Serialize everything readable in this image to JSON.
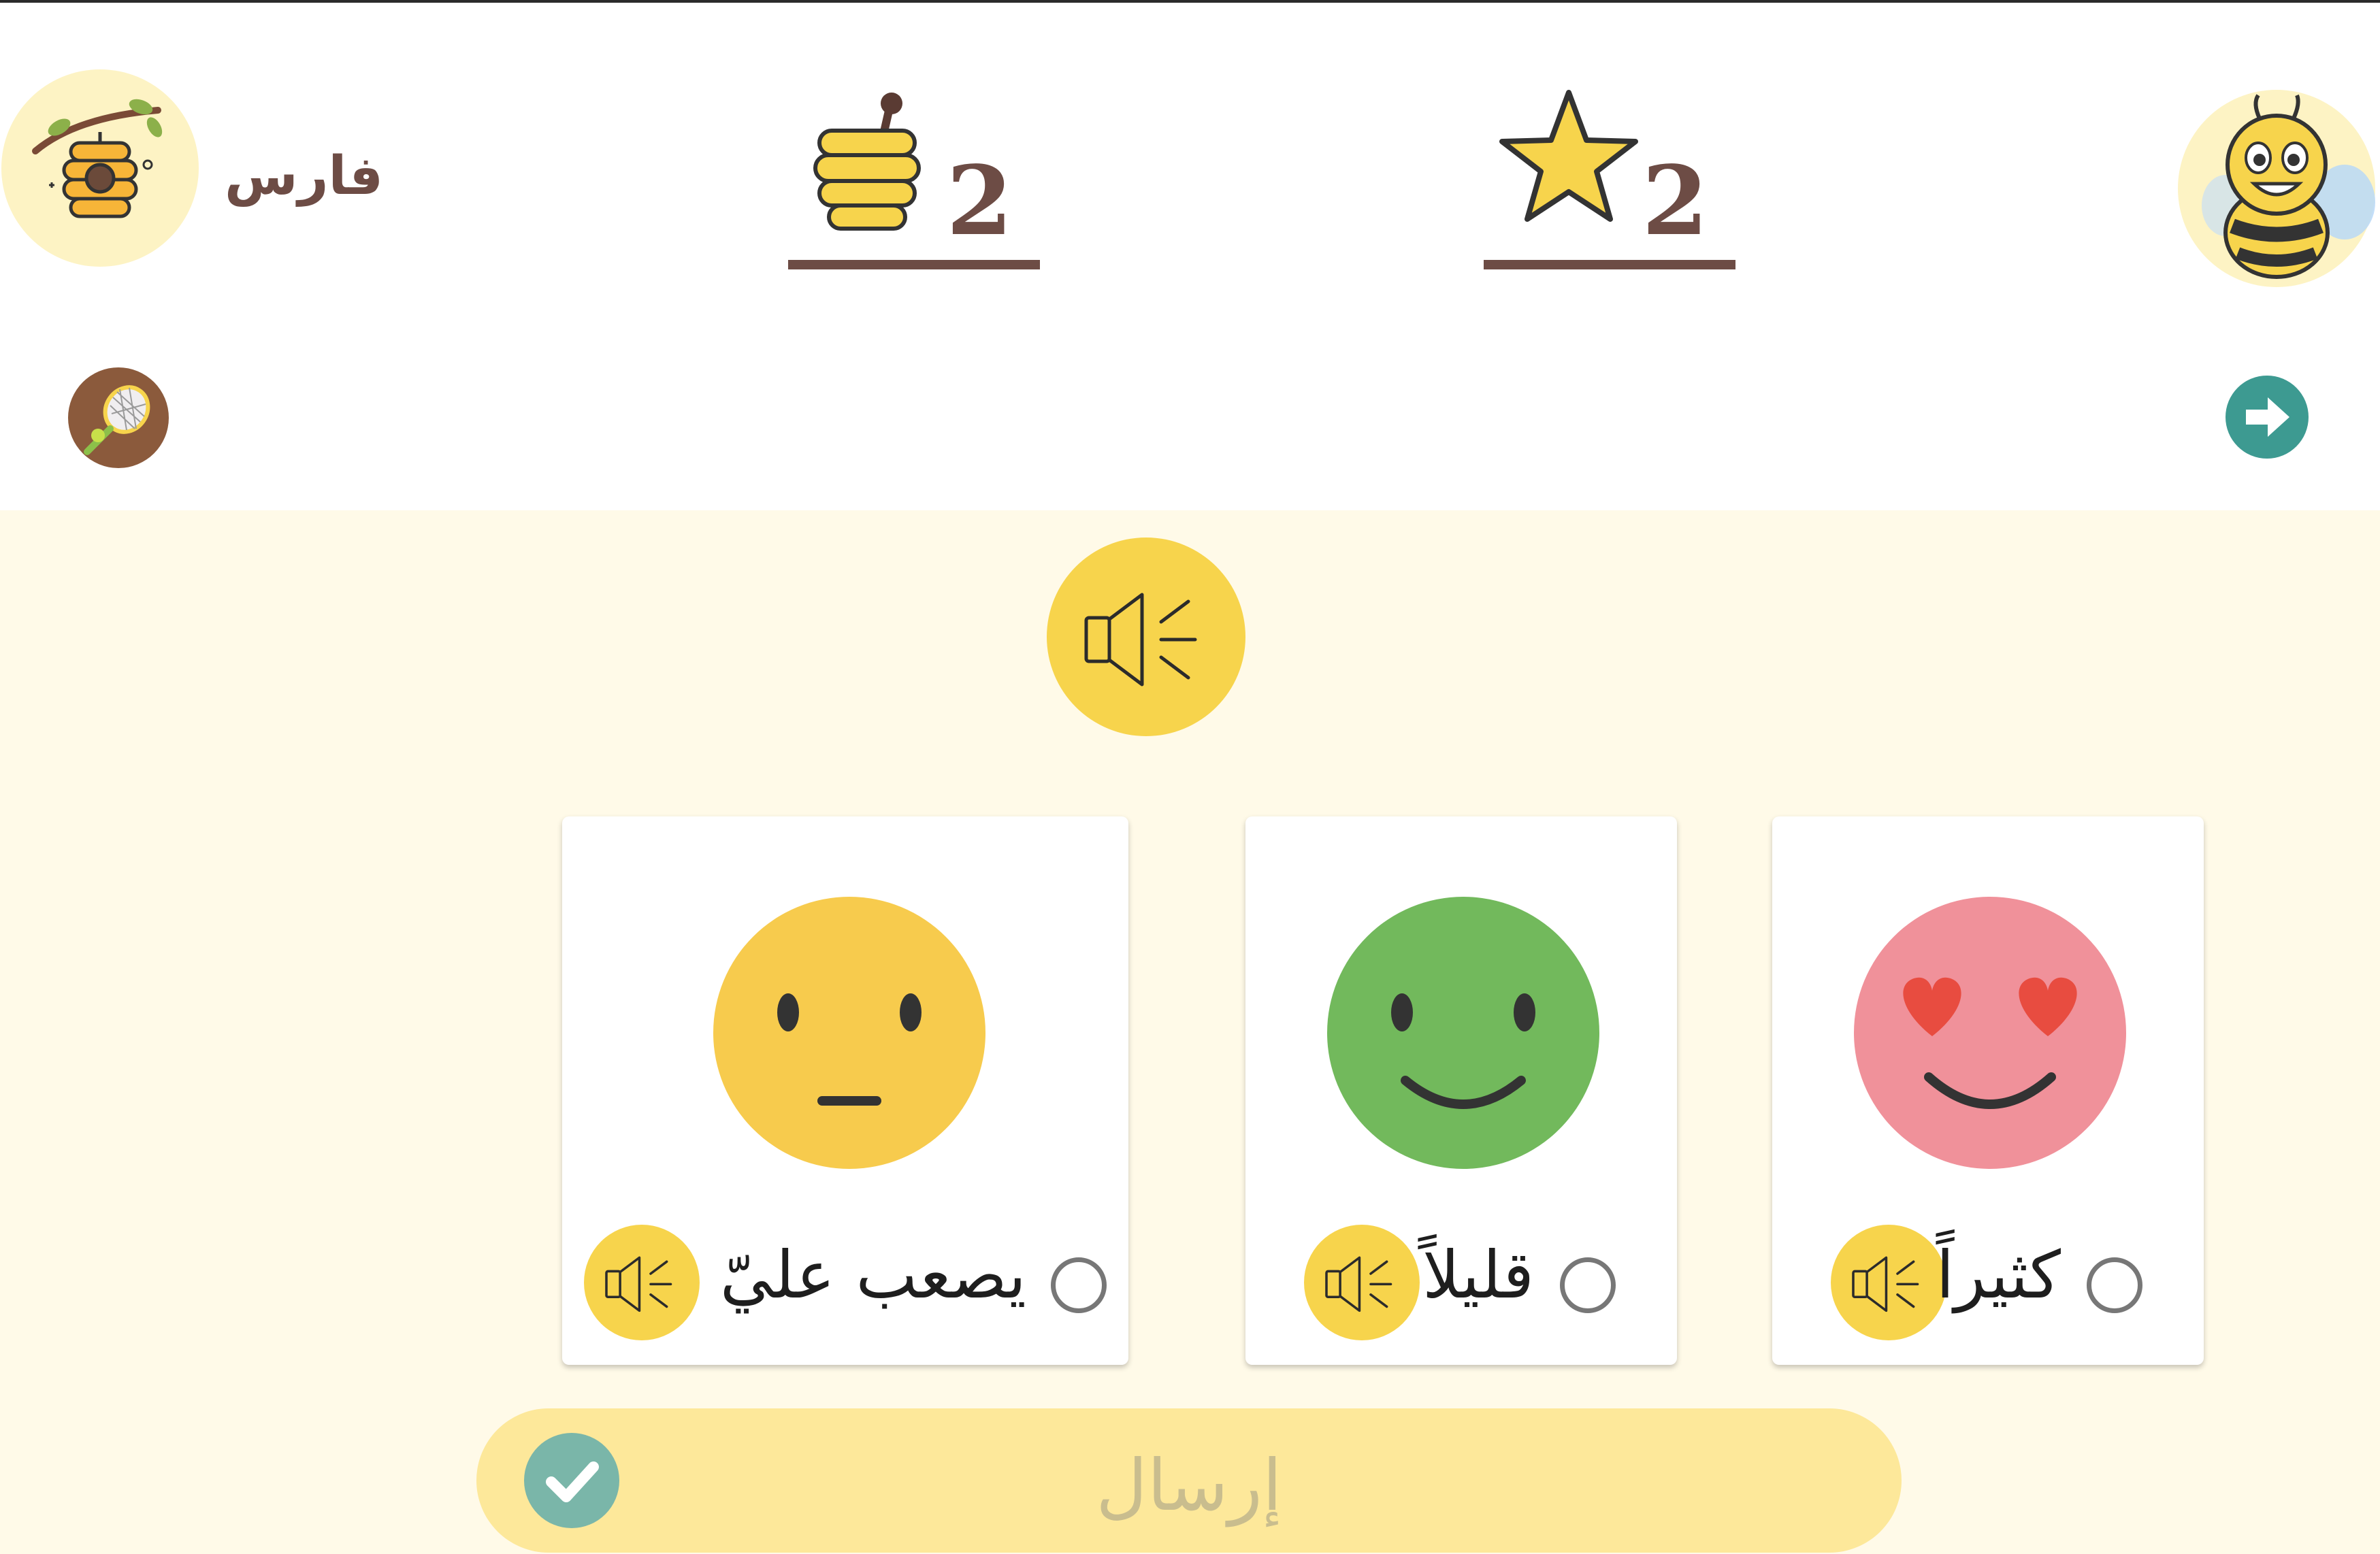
{
  "header": {
    "user_name": "فارس",
    "honey_count": "2",
    "star_count": "2"
  },
  "options": [
    {
      "label": "يصعب عليّ",
      "face": "neutral-face",
      "color": "#f7cb4d"
    },
    {
      "label": "قليلاً",
      "face": "smile-face",
      "color": "#72b95c"
    },
    {
      "label": "كثيراً",
      "face": "heart-eyes-face",
      "color": "#f0919a"
    }
  ],
  "submit": {
    "label": "إرسال"
  },
  "colors": {
    "brown": "#6d4c45",
    "yellow": "#f7d44c",
    "teal": "#3d9a91",
    "background": "#fffae8"
  }
}
